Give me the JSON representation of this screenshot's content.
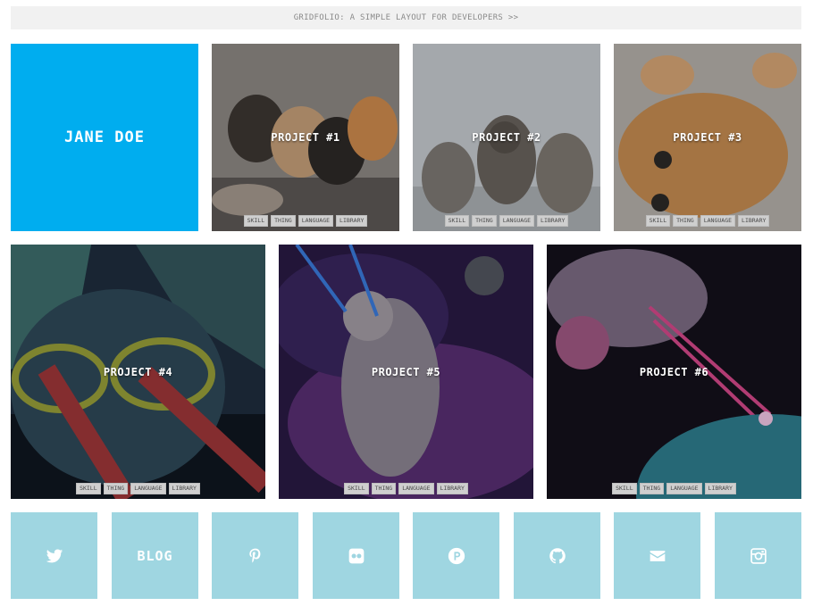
{
  "banner": {
    "text": "GRIDFOLIO: A SIMPLE LAYOUT FOR DEVELOPERS >>"
  },
  "profile": {
    "name": "JANE DOE"
  },
  "projects": [
    {
      "title": "PROJECT #1",
      "tags": [
        "SKILL",
        "THING",
        "LANGUAGE",
        "LIBRARY"
      ]
    },
    {
      "title": "PROJECT #2",
      "tags": [
        "SKILL",
        "THING",
        "LANGUAGE",
        "LIBRARY"
      ]
    },
    {
      "title": "PROJECT #3",
      "tags": [
        "SKILL",
        "THING",
        "LANGUAGE",
        "LIBRARY"
      ]
    },
    {
      "title": "PROJECT #4",
      "tags": [
        "SKILL",
        "THING",
        "LANGUAGE",
        "LIBRARY"
      ]
    },
    {
      "title": "PROJECT #5",
      "tags": [
        "SKILL",
        "THING",
        "LANGUAGE",
        "LIBRARY"
      ]
    },
    {
      "title": "PROJECT #6",
      "tags": [
        "SKILL",
        "THING",
        "LANGUAGE",
        "LIBRARY"
      ]
    }
  ],
  "social": [
    {
      "icon": "twitter-icon"
    },
    {
      "icon": "blog",
      "label": "BLOG"
    },
    {
      "icon": "pinterest-icon"
    },
    {
      "icon": "flickr-icon"
    },
    {
      "icon": "producthunt-icon"
    },
    {
      "icon": "github-icon"
    },
    {
      "icon": "mail-icon"
    },
    {
      "icon": "instagram-icon"
    }
  ],
  "colors": {
    "accent": "#00adef",
    "social_bg": "#9fd6e1",
    "banner_bg": "#f1f1f1"
  }
}
